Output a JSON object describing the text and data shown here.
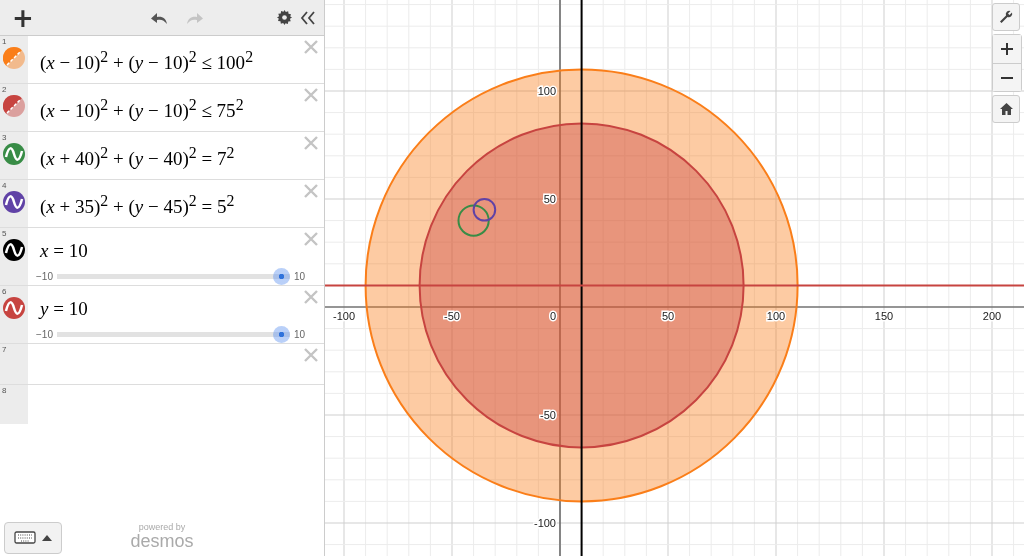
{
  "toolbar": {
    "add": "+"
  },
  "expressions": [
    {
      "number": "1",
      "kind": "inequality",
      "color": "#fa7e19",
      "latex": "(*x* − 10)$^{2}$ + (*y* − 10)$^{2}$ ≤ 100$^{2}$"
    },
    {
      "number": "2",
      "kind": "inequality",
      "color": "#c74440",
      "latex": "(*x* − 10)$^{2}$ + (*y* − 10)$^{2}$ ≤ 75$^{2}$"
    },
    {
      "number": "3",
      "kind": "equation",
      "color": "#388c46",
      "latex": "(*x* + 40)$^{2}$ + (*y* − 40)$^{2}$ = 7$^{2}$"
    },
    {
      "number": "4",
      "kind": "equation",
      "color": "#6042a6",
      "latex": "(*x* + 35)$^{2}$ + (*y* − 45)$^{2}$ = 5$^{2}$"
    },
    {
      "number": "5",
      "kind": "slider",
      "color": "#000000",
      "latex": "*x* = 10",
      "min": "−10",
      "max": "10",
      "level": 1
    },
    {
      "number": "6",
      "kind": "slider",
      "color": "#c74440",
      "latex": "*y* = 10",
      "min": "−10",
      "max": "10",
      "level": 1
    },
    {
      "number": "7",
      "kind": "empty"
    },
    {
      "number": "8",
      "kind": "placeholder"
    }
  ],
  "branding": {
    "line_1": "powered by",
    "line_2": "desmos"
  },
  "graph": {
    "x_labels": [
      "-100",
      "-50",
      "0",
      "50",
      "100",
      "150",
      "200"
    ],
    "y_labels": [
      "100",
      "50",
      "-50",
      "-100"
    ]
  }
}
